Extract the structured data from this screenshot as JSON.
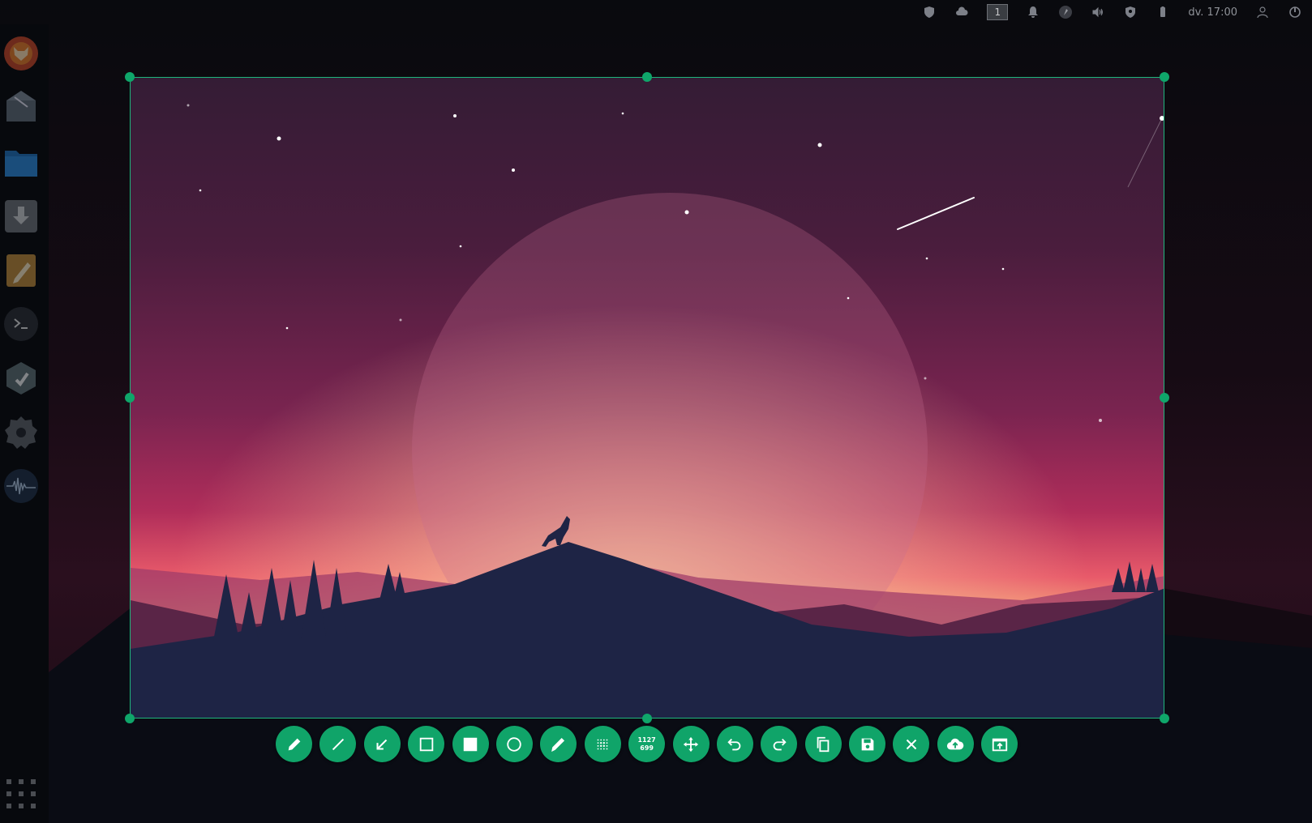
{
  "topbar": {
    "workspace_number": "1",
    "clock": "dv. 17:00",
    "icons": [
      "shield-check-icon",
      "cloud-icon",
      "workspace-indicator",
      "bell-icon",
      "avatar-icon",
      "volume-icon",
      "vpn-shield-icon",
      "battery-icon",
      "user-icon",
      "power-icon"
    ]
  },
  "dock": {
    "items": [
      "firefox-icon",
      "mail-icon",
      "folder-icon",
      "download-icon",
      "text-editor-icon",
      "terminal-icon",
      "software-center-icon",
      "settings-icon",
      "audio-wave-icon"
    ],
    "apps_grid": "apps-grid-icon"
  },
  "selection": {
    "width": 1127,
    "height": 699
  },
  "toolbar": {
    "tools": [
      "pencil-icon",
      "line-icon",
      "arrow-icon",
      "rectangle-icon",
      "filled-rectangle-icon",
      "circle-icon",
      "marker-icon",
      "pixelate-icon",
      "selection-size",
      "move-icon",
      "undo-icon",
      "redo-icon",
      "copy-icon",
      "save-icon",
      "close-icon",
      "upload-icon",
      "open-with-icon"
    ],
    "size_width": "1127",
    "size_height": "699"
  },
  "colors": {
    "accent": "#10a469",
    "selection_border": "#1fb57c",
    "desktop_bg": "#05070b"
  }
}
